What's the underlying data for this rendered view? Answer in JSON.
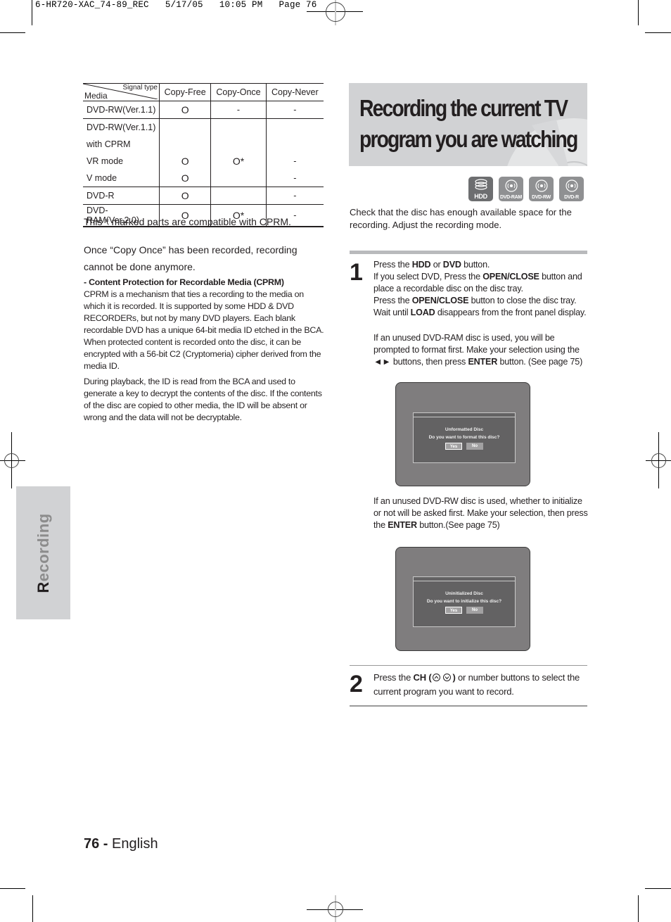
{
  "print_slug": "6-HR720-XAC_74-89_REC   5/17/05   10:05 PM   Page 76",
  "side_tab": {
    "label_first": "R",
    "label_rest": "ecording"
  },
  "table": {
    "corner_signal": "Signal type",
    "corner_media": "Media",
    "headers": [
      "Copy-Free",
      "Copy-Once",
      "Copy-Never"
    ],
    "rows": [
      {
        "media": "DVD-RW(Ver.1.1)",
        "free": "O",
        "once": "-",
        "never": "-"
      },
      {
        "media": "DVD-RW(Ver.1.1)",
        "free": "",
        "once": "",
        "never": ""
      },
      {
        "media": "with CPRM",
        "free": "",
        "once": "",
        "never": ""
      },
      {
        "media": "VR mode",
        "free": "O",
        "once": "O*",
        "never": "-"
      },
      {
        "media": "V mode",
        "free": "O",
        "once": "",
        "never": "-"
      },
      {
        "media": "DVD-R",
        "free": "O",
        "once": "",
        "never": "-"
      },
      {
        "media": "DVD-RAM(Ver.2.0)",
        "free": "O",
        "once": "O*",
        "never": "-"
      }
    ]
  },
  "notes": {
    "cprm_compat": "This * marked parts are compatible with CPRM.",
    "copy_once": "Once “Copy Once” has been recorded, recording cannot be done anymore.",
    "cprm_heading": "- Content Protection for Recordable Media (CPRM)",
    "cprm_p1": "CPRM is a mechanism that ties a recording to the media on which it is recorded. It is supported by some HDD & DVD RECORDERs, but not by many DVD players. Each blank recordable DVD has a unique 64-bit media ID etched in the BCA. When protected content is recorded onto the disc, it can be encrypted with a 56-bit C2 (Cryptomeria) cipher derived from the media ID.",
    "cprm_p2": "During playback, the ID is read from the BCA and used to generate a key to decrypt the contents of the disc. If the contents of the disc are copied to other media, the ID will be absent or wrong and the data will not be decryptable."
  },
  "title": {
    "line1": "Recording the current TV",
    "line2": "program you are watching"
  },
  "media_icons": [
    {
      "name": "hdd-icon",
      "label": "HDD"
    },
    {
      "name": "dvd-ram-icon",
      "label": "DVD-RAM"
    },
    {
      "name": "dvd-rw-icon",
      "label": "DVD-RW"
    },
    {
      "name": "dvd-r-icon",
      "label": "DVD-R"
    }
  ],
  "intro": "Check that the disc has enough available space for the recording. Adjust the recording mode.",
  "step1": {
    "number": "1",
    "l1_pre": "Press the ",
    "l1_b1": "HDD",
    "l1_mid": " or ",
    "l1_b2": "DVD",
    "l1_post": " button.",
    "l2_pre": "If you select DVD, Press the ",
    "l2_b": "OPEN/CLOSE",
    "l2_post": " button and place a recordable disc on the disc tray.",
    "l3_pre": "Press the ",
    "l3_b": "OPEN/CLOSE",
    "l3_post": " button to close the disc tray.",
    "l4_pre": "Wait until ",
    "l4_b": "LOAD",
    "l4_post": " disappears from the front panel display.",
    "ram_pre": "If an unused DVD-RAM disc is used, you will be prompted to format first. Make your selection using the ◄► buttons, then press ",
    "ram_b": "ENTER",
    "ram_post": " button. (See page 75)",
    "rw_pre": "If an unused DVD-RW disc is used, whether to initialize or not will be asked first. Make your selection, then press the ",
    "rw_b": "ENTER",
    "rw_post": " button.(See page 75)"
  },
  "screen1": {
    "title": "Unformatted Disc",
    "question": "Do you want to format this disc?",
    "yes": "Yes",
    "no": "No"
  },
  "screen2": {
    "title": "Uninitialized Disc",
    "question": "Do you want to initialize this disc?",
    "yes": "Yes",
    "no": "No"
  },
  "step2": {
    "number": "2",
    "pre": "Press the ",
    "b": "CH (",
    "b_close": ")",
    "post": " or number buttons to select the current program you want to record."
  },
  "footer": {
    "page": "76 -",
    "lang": " English"
  }
}
